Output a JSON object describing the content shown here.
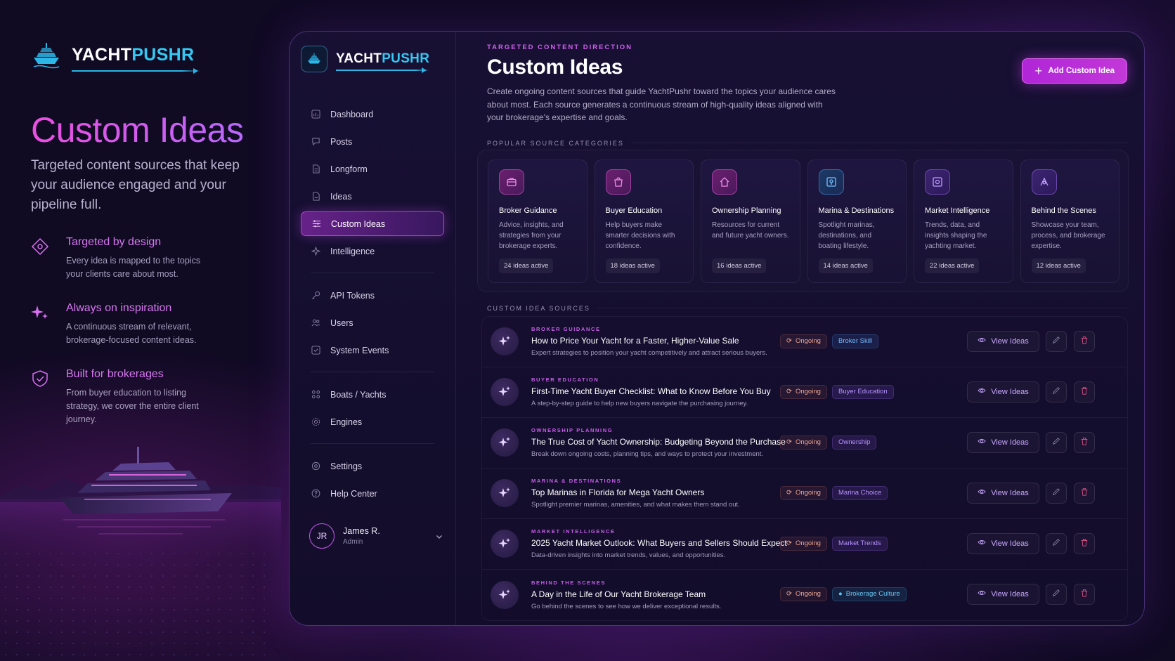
{
  "brand": {
    "part1": "YACHT",
    "part2": "PUSHR"
  },
  "hero": {
    "title": "Custom Ideas",
    "subtitle": "Targeted content sources that keep your audience engaged and your pipeline full.",
    "features": [
      {
        "icon": "diamond-target-icon",
        "title": "Targeted by design",
        "text": "Every idea is mapped to the topics your clients care about most."
      },
      {
        "icon": "sparkle-icon",
        "title": "Always on inspiration",
        "text": "A continuous stream of relevant, brokerage-focused content ideas."
      },
      {
        "icon": "shield-check-icon",
        "title": "Built for brokerages",
        "text": "From buyer education to listing strategy, we cover the entire client journey."
      }
    ]
  },
  "sidebar": {
    "groups": [
      [
        {
          "label": "Dashboard",
          "icon": "chart-icon"
        },
        {
          "label": "Posts",
          "icon": "chat-icon"
        },
        {
          "label": "Longform",
          "icon": "document-icon"
        },
        {
          "label": "Ideas",
          "icon": "file-icon"
        },
        {
          "label": "Custom Ideas",
          "icon": "sliders-icon",
          "active": true
        },
        {
          "label": "Intelligence",
          "icon": "brain-icon"
        }
      ],
      [
        {
          "label": "API Tokens",
          "icon": "key-icon"
        },
        {
          "label": "Users",
          "icon": "users-icon"
        },
        {
          "label": "System Events",
          "icon": "log-icon"
        }
      ],
      [
        {
          "label": "Boats / Yachts",
          "icon": "grid-icon"
        },
        {
          "label": "Engines",
          "icon": "cog-icon"
        }
      ],
      [
        {
          "label": "Settings",
          "icon": "settings-icon"
        },
        {
          "label": "Help Center",
          "icon": "help-icon"
        }
      ]
    ],
    "user": {
      "initials": "JR",
      "name": "James R.",
      "role": "Admin"
    }
  },
  "main": {
    "eyebrow": "TARGETED CONTENT DIRECTION",
    "title": "Custom Ideas",
    "description": "Create ongoing content sources that guide YachtPushr toward the topics your audience cares about most. Each source generates a continuous stream of high-quality ideas aligned with your brokerage's expertise and goals.",
    "add_button": "Add Custom Idea",
    "categories_label": "POPULAR SOURCE CATEGORIES",
    "categories": [
      {
        "title": "Broker Guidance",
        "desc": "Advice, insights, and strategies from your brokerage experts.",
        "count": "24 ideas active",
        "tone": "pink"
      },
      {
        "title": "Buyer Education",
        "desc": "Help buyers make smarter decisions with confidence.",
        "count": "18 ideas active",
        "tone": "pink"
      },
      {
        "title": "Ownership Planning",
        "desc": "Resources for current and future yacht owners.",
        "count": "16 ideas active",
        "tone": "pink"
      },
      {
        "title": "Marina & Destinations",
        "desc": "Spotlight marinas, destinations, and boating lifestyle.",
        "count": "14 ideas active",
        "tone": "blue"
      },
      {
        "title": "Market Intelligence",
        "desc": "Trends, data, and insights shaping the yachting market.",
        "count": "22 ideas active",
        "tone": "violet"
      },
      {
        "title": "Behind the Scenes",
        "desc": "Showcase your team, process, and brokerage expertise.",
        "count": "12 ideas active",
        "tone": "violet"
      }
    ],
    "sources_label": "CUSTOM IDEA SOURCES",
    "sources": [
      {
        "tag": "BROKER GUIDANCE",
        "title": "How to Price Your Yacht for a Faster, Higher-Value Sale",
        "desc": "Expert strategies to position your yacht competitively and attract serious buyers.",
        "status": "Ongoing",
        "topic": "Broker Skill",
        "topic_tone": "blue",
        "view": "View Ideas"
      },
      {
        "tag": "BUYER EDUCATION",
        "title": "First-Time Yacht Buyer Checklist: What to Know Before You Buy",
        "desc": "A step-by-step guide to help new buyers navigate the purchasing journey.",
        "status": "Ongoing",
        "topic": "Buyer Education",
        "topic_tone": "violet",
        "view": "View Ideas"
      },
      {
        "tag": "OWNERSHIP PLANNING",
        "title": "The True Cost of Yacht Ownership: Budgeting Beyond the Purchase",
        "desc": "Break down ongoing costs, planning tips, and ways to protect your investment.",
        "status": "Ongoing",
        "topic": "Ownership",
        "topic_tone": "violet",
        "view": "View Ideas"
      },
      {
        "tag": "MARINA & DESTINATIONS",
        "title": "Top Marinas in Florida for Mega Yacht Owners",
        "desc": "Spotlight premier marinas, amenities, and what makes them stand out.",
        "status": "Ongoing",
        "topic": "Marina Choice",
        "topic_tone": "violet",
        "view": "View Ideas"
      },
      {
        "tag": "MARKET INTELLIGENCE",
        "title": "2025 Yacht Market Outlook: What Buyers and Sellers Should Expect",
        "desc": "Data-driven insights into market trends, values, and opportunities.",
        "status": "Ongoing",
        "topic": "Market Trends",
        "topic_tone": "violet",
        "view": "View Ideas"
      },
      {
        "tag": "BEHIND THE SCENES",
        "title": "A Day in the Life of Our Yacht Brokerage Team",
        "desc": "Go behind the scenes to see how we deliver exceptional results.",
        "status": "Ongoing",
        "topic": "Brokerage Culture",
        "topic_tone": "teal",
        "view": "View Ideas"
      }
    ]
  }
}
